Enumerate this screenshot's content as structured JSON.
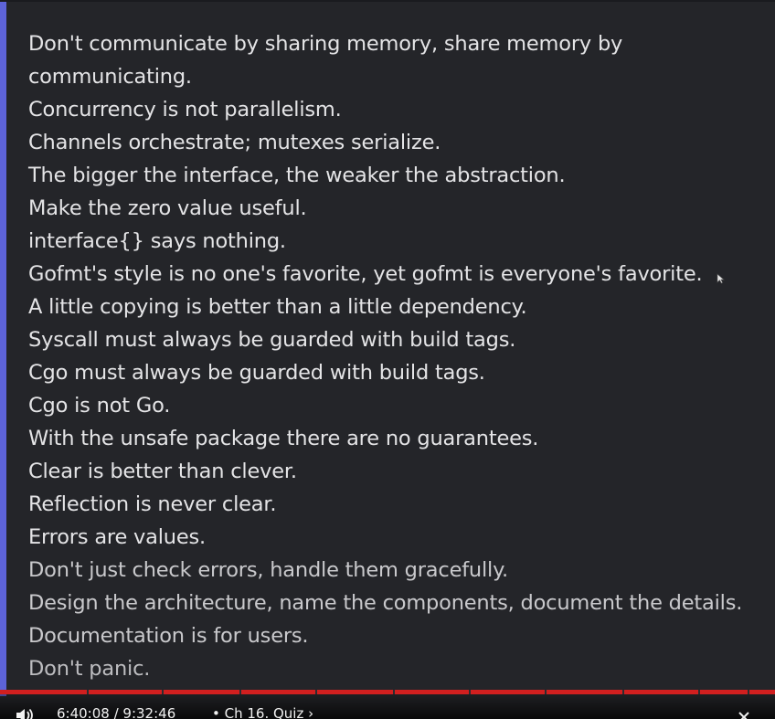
{
  "proverbs": [
    "Don't communicate by sharing memory, share memory by communicating.",
    "Concurrency is not parallelism.",
    "Channels orchestrate; mutexes serialize.",
    "The bigger the interface, the weaker the abstraction.",
    "Make the zero value useful.",
    "interface{} says nothing.",
    "Gofmt's style is no one's favorite, yet gofmt is everyone's favorite.",
    "A little copying is better than a little dependency.",
    "Syscall must always be guarded with build tags.",
    "Cgo must always be guarded with build tags.",
    "Cgo is not Go.",
    "With the unsafe package there are no guarantees.",
    "Clear is better than clever.",
    "Reflection is never clear.",
    "Errors are values.",
    "Don't just check errors, handle them gracefully.",
    "Design the architecture, name the components, document the details.",
    "Documentation is for users.",
    "Don't panic."
  ],
  "player": {
    "time": "6:40:08 / 9:32:46",
    "chapter": "• Ch 16. Quiz ›",
    "volume_icon": "volume-icon",
    "close_icon": "close-icon",
    "accent_color": "#5d63d8",
    "progress_color": "#d11f1f"
  }
}
